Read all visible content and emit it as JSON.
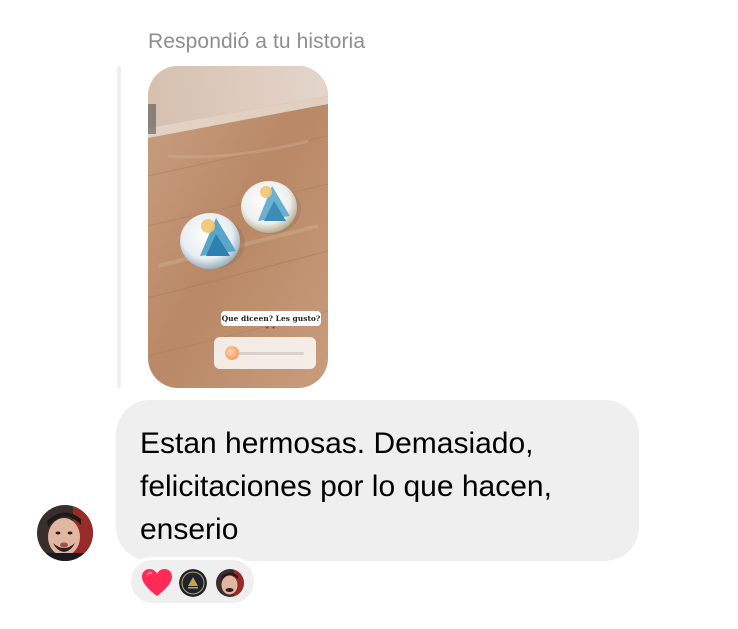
{
  "story_reply": {
    "label": "Respondió a tu historia",
    "story_sticker_question": "Que diceen? Les gusto?",
    "story_sticker_dots": "• •"
  },
  "message": {
    "text": "Estan hermosas. Demasiado,\nfelicitaciones por lo que hacen,\nenserio"
  },
  "sender": {
    "avatar_icon": "user-avatar-photo"
  },
  "reactions": {
    "emoji": "heart",
    "reactor_icons": [
      "reactor-avatar-logo",
      "reactor-avatar-photo"
    ]
  },
  "colors": {
    "bubble": "#efefef",
    "label": "#8e8e8e",
    "heart": "#ff2b56"
  }
}
